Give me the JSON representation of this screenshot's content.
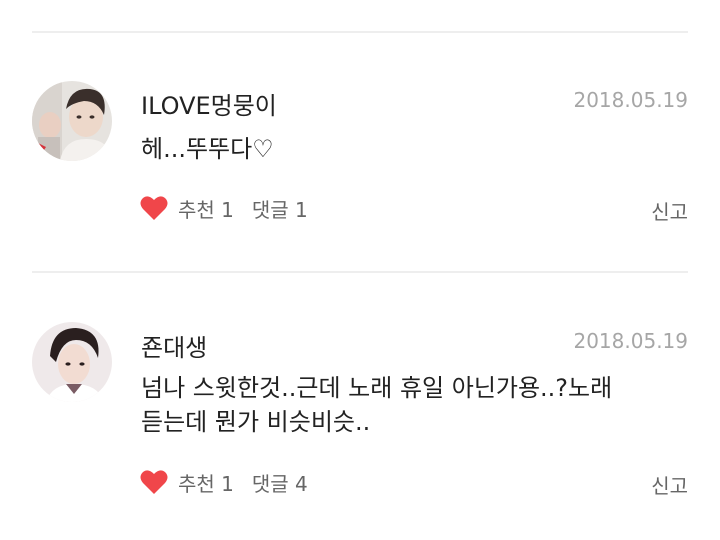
{
  "comments": [
    {
      "username": "ILOVE멍뭉이",
      "date": "2018.05.19",
      "text_lines": [
        "헤...뚜뚜다♡"
      ],
      "like_label": "추천 1",
      "reply_label": "댓글 1",
      "report_label": "신고"
    },
    {
      "username": "죤대생",
      "date": "2018.05.19",
      "text_lines": [
        "넘나 스윗한것..근데 노래 휴일 아닌가용..?노래",
        "듣는데 뭔가 비슷비슷.."
      ],
      "like_label": "추천 1",
      "reply_label": "댓글 4",
      "report_label": "신고"
    }
  ],
  "icons": {
    "like": "heart-icon"
  },
  "colors": {
    "heart": "#f0464a",
    "date": "#a6a6a6",
    "divider": "#eeeeee"
  }
}
